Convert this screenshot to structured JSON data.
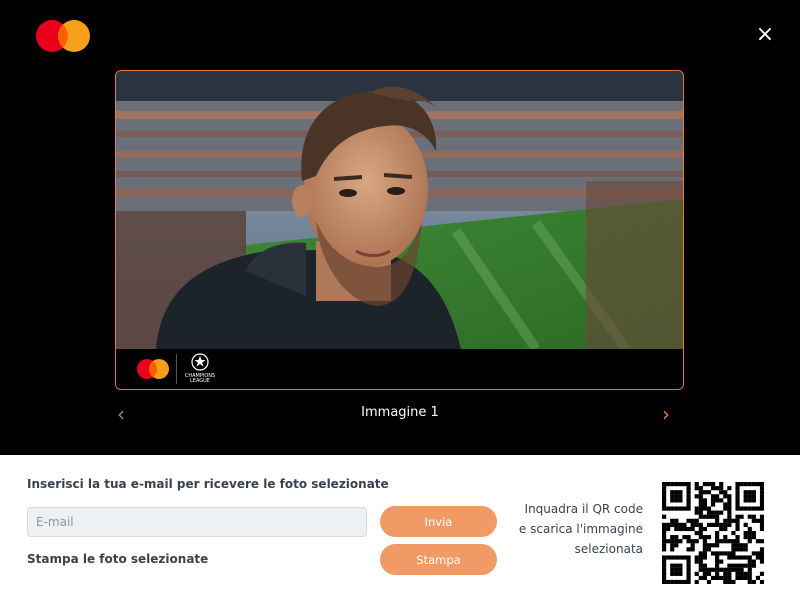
{
  "header": {
    "brand": "mastercard-logo",
    "close_label": "×"
  },
  "viewer": {
    "photo_caption": "",
    "badge_text_1": "CHAMPIONS",
    "badge_text_2": "LEAGUE",
    "image_label": "Immagine 1",
    "prev_glyph": "‹",
    "next_glyph": "›"
  },
  "form": {
    "email_label": "Inserisci la tua e-mail per ricevere le foto selezionate",
    "email_placeholder": "E-mail",
    "email_value": "",
    "send_button": "Invia",
    "print_label": "Stampa le foto selezionate",
    "print_button": "Stampa"
  },
  "qr": {
    "text_line1": "Inquadra il QR code",
    "text_line2": "e scarica l'immagine",
    "text_line3": "selezionata"
  },
  "colors": {
    "accent": "#e8783a",
    "button": "#f19a66",
    "mc_red": "#eb001b",
    "mc_orange": "#f79e1b"
  }
}
